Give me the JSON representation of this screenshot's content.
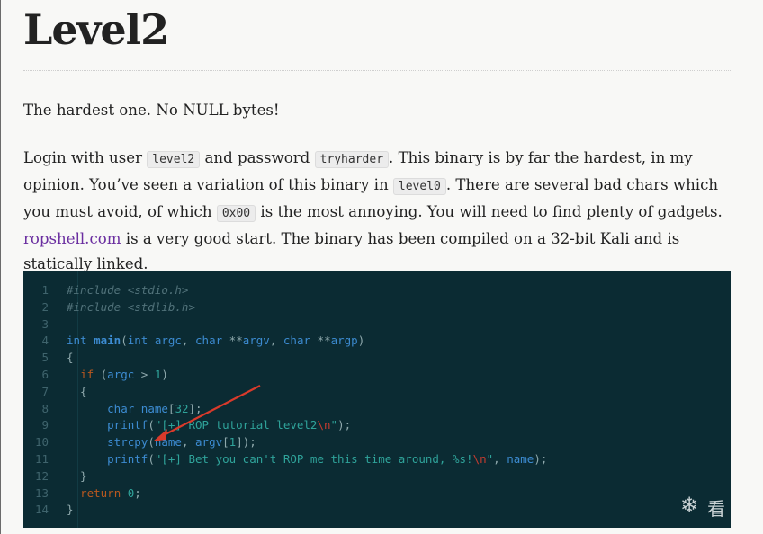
{
  "page": {
    "title": "Level2",
    "intro": "The hardest one. No NULL bytes!",
    "para2": {
      "t1": "Login with user ",
      "c_user": "level2",
      "t2": " and password ",
      "c_pass": "tryharder",
      "t3": ". This binary is by far the hardest, in my opinion. You’ve seen a variation of this binary in ",
      "c_level0": "level0",
      "t4": ". There are several bad chars which you must avoid, of which ",
      "c_null": "0x00",
      "t5": " is the most annoying. You will need to find plenty of gadgets. ",
      "link": "ropshell.com",
      "t6": " is a very good start. The binary has been compiled on a 32-bit Kali and is statically linked."
    }
  },
  "code": {
    "lines": [
      {
        "n": "1",
        "tokens": [
          {
            "t": "#include <stdio.h>",
            "k": "comment"
          }
        ]
      },
      {
        "n": "2",
        "tokens": [
          {
            "t": "#include <stdlib.h>",
            "k": "comment"
          }
        ]
      },
      {
        "n": "3",
        "tokens": []
      },
      {
        "n": "4",
        "tokens": [
          {
            "t": "int ",
            "k": "keyword"
          },
          {
            "t": "main",
            "k": "func"
          },
          {
            "t": "(",
            "k": "plain"
          },
          {
            "t": "int ",
            "k": "keyword"
          },
          {
            "t": "argc",
            "k": "var"
          },
          {
            "t": ", ",
            "k": "plain"
          },
          {
            "t": "char ",
            "k": "keyword"
          },
          {
            "t": "**",
            "k": "plain"
          },
          {
            "t": "argv",
            "k": "var"
          },
          {
            "t": ", ",
            "k": "plain"
          },
          {
            "t": "char ",
            "k": "keyword"
          },
          {
            "t": "**",
            "k": "plain"
          },
          {
            "t": "argp",
            "k": "var"
          },
          {
            "t": ")",
            "k": "plain"
          }
        ]
      },
      {
        "n": "5",
        "tokens": [
          {
            "t": "{",
            "k": "plain"
          }
        ]
      },
      {
        "n": "6",
        "tokens": [
          {
            "t": "  ",
            "k": "plain"
          },
          {
            "t": "if ",
            "k": "ctrl"
          },
          {
            "t": "(",
            "k": "plain"
          },
          {
            "t": "argc",
            "k": "var"
          },
          {
            "t": " > ",
            "k": "plain"
          },
          {
            "t": "1",
            "k": "num"
          },
          {
            "t": ")",
            "k": "plain"
          }
        ]
      },
      {
        "n": "7",
        "tokens": [
          {
            "t": "  {",
            "k": "plain"
          }
        ]
      },
      {
        "n": "8",
        "tokens": [
          {
            "t": "      ",
            "k": "plain"
          },
          {
            "t": "char ",
            "k": "keyword"
          },
          {
            "t": "name",
            "k": "var"
          },
          {
            "t": "[",
            "k": "plain"
          },
          {
            "t": "32",
            "k": "num"
          },
          {
            "t": "];",
            "k": "plain"
          }
        ]
      },
      {
        "n": "9",
        "tokens": [
          {
            "t": "      ",
            "k": "plain"
          },
          {
            "t": "printf",
            "k": "keyword"
          },
          {
            "t": "(",
            "k": "plain"
          },
          {
            "t": "\"[+] ROP tutorial level2",
            "k": "string"
          },
          {
            "t": "\\n",
            "k": "esc"
          },
          {
            "t": "\"",
            "k": "string"
          },
          {
            "t": ");",
            "k": "plain"
          }
        ]
      },
      {
        "n": "10",
        "tokens": [
          {
            "t": "      ",
            "k": "plain"
          },
          {
            "t": "strcpy",
            "k": "keyword"
          },
          {
            "t": "(",
            "k": "plain"
          },
          {
            "t": "name",
            "k": "var"
          },
          {
            "t": ", ",
            "k": "plain"
          },
          {
            "t": "argv",
            "k": "var"
          },
          {
            "t": "[",
            "k": "plain"
          },
          {
            "t": "1",
            "k": "num"
          },
          {
            "t": "]);",
            "k": "plain"
          }
        ]
      },
      {
        "n": "11",
        "tokens": [
          {
            "t": "      ",
            "k": "plain"
          },
          {
            "t": "printf",
            "k": "keyword"
          },
          {
            "t": "(",
            "k": "plain"
          },
          {
            "t": "\"[+] Bet you can't ROP me this time around, %s!",
            "k": "string"
          },
          {
            "t": "\\n",
            "k": "esc"
          },
          {
            "t": "\"",
            "k": "string"
          },
          {
            "t": ", ",
            "k": "plain"
          },
          {
            "t": "name",
            "k": "var"
          },
          {
            "t": ");",
            "k": "plain"
          }
        ]
      },
      {
        "n": "12",
        "tokens": [
          {
            "t": "  }",
            "k": "plain"
          }
        ]
      },
      {
        "n": "13",
        "tokens": [
          {
            "t": "  ",
            "k": "plain"
          },
          {
            "t": "return ",
            "k": "ctrl"
          },
          {
            "t": "0",
            "k": "num"
          },
          {
            "t": ";",
            "k": "plain"
          }
        ]
      },
      {
        "n": "14",
        "tokens": [
          {
            "t": "}",
            "k": "plain"
          }
        ]
      }
    ]
  },
  "annotation": {
    "arrow_color": "#d93a2b"
  },
  "watermark": {
    "icon": "snowflake-icon",
    "text": "看"
  }
}
